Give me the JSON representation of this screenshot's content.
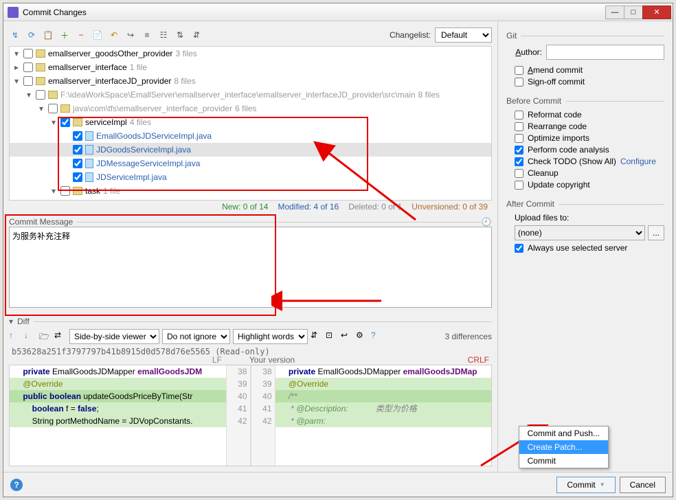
{
  "window": {
    "title": "Commit Changes"
  },
  "toolbar": {
    "changelist_label": "Changelist:",
    "changelist_value": "Default"
  },
  "tree": {
    "rows": [
      {
        "indent": 0,
        "chev": "▾",
        "checked": false,
        "type": "folder",
        "label": "emallserver_goodsOther_provider",
        "meta": "3 files"
      },
      {
        "indent": 0,
        "chev": "▸",
        "checked": false,
        "type": "folder",
        "label": "emallserver_interface",
        "meta": "1 file"
      },
      {
        "indent": 0,
        "chev": "▾",
        "checked": false,
        "type": "folder",
        "label": "emallserver_interfaceJD_provider",
        "meta": "8 files"
      },
      {
        "indent": 1,
        "chev": "▾",
        "checked": false,
        "type": "folder",
        "label": "F:\\ideaWorkSpace\\EmallServer\\emallserver_interface\\emallserver_interfaceJD_provider\\src\\main",
        "meta": "8 files",
        "gray_label": true
      },
      {
        "indent": 2,
        "chev": "▾",
        "checked": false,
        "type": "folder",
        "label": "java\\com\\tfs\\emallserver_interface_provider",
        "meta": "6 files",
        "gray_label": true
      },
      {
        "indent": 3,
        "chev": "▾",
        "checked": true,
        "type": "folder",
        "label": "serviceImpl",
        "meta": "4 files"
      },
      {
        "indent": 4,
        "chev": "",
        "checked": true,
        "type": "file",
        "label": "EmallGoodsJDServiceImpl.java",
        "link": true
      },
      {
        "indent": 4,
        "chev": "",
        "checked": true,
        "type": "file",
        "label": "JDGoodsServiceImpl.java",
        "link": true,
        "sel": true
      },
      {
        "indent": 4,
        "chev": "",
        "checked": true,
        "type": "file",
        "label": "JDMessageServiceImpl.java",
        "link": true
      },
      {
        "indent": 4,
        "chev": "",
        "checked": true,
        "type": "file",
        "label": "JDServiceImpl.java",
        "link": true
      },
      {
        "indent": 3,
        "chev": "▾",
        "checked": false,
        "type": "folder",
        "label": "task",
        "meta": "1 file"
      }
    ],
    "status": {
      "new": "New: 0 of 14",
      "modified": "Modified: 4 of 16",
      "deleted": "Deleted: 0 of 1",
      "unversioned": "Unversioned: 0 of 39"
    }
  },
  "commit_message": {
    "label": "Commit Message",
    "text": "为服务补充注释"
  },
  "diff": {
    "label": "Diff",
    "viewer": "Side-by-side viewer",
    "ignore": "Do not ignore",
    "highlight": "Highlight words",
    "count": "3 differences",
    "hash": "b53628a251f3797797b41b8915d0d578d76e5565 (Read-only)",
    "left_enc": "LF",
    "right_label": "Your version",
    "right_enc": "CRLF",
    "lines": [
      {
        "ln": 38,
        "left": "    private EmallGoodsJDMapper emallGoodsJDM",
        "right": "    private EmallGoodsJDMapper emallGoodsJDMap",
        "cls": ""
      },
      {
        "ln": 39,
        "left": "    @Override",
        "right": "    @Override",
        "cls": "green"
      },
      {
        "ln": 40,
        "left": "    public boolean updateGoodsPriceByTime(Str",
        "right": "    /**",
        "cls": "green-mid"
      },
      {
        "ln": 41,
        "left": "        boolean f = false;",
        "right": "     * @Description:            类型为价格",
        "cls": "green"
      },
      {
        "ln": 42,
        "left": "        String portMethodName = JDVopConstants.",
        "right": "     * @parm:",
        "cls": "green"
      }
    ]
  },
  "context_menu": {
    "items": [
      "Commit and Push...",
      "Create Patch...",
      "Commit"
    ],
    "selected": 1
  },
  "footer": {
    "commit": "Commit",
    "cancel": "Cancel"
  },
  "right": {
    "git": "Git",
    "author_label": "Author:",
    "amend": "Amend commit",
    "signoff": "Sign-off commit",
    "before_commit": "Before Commit",
    "reformat": "Reformat code",
    "rearrange": "Rearrange code",
    "optimize": "Optimize imports",
    "analysis": "Perform code analysis",
    "todo": "Check TODO (Show All)",
    "configure": "Configure",
    "cleanup": "Cleanup",
    "copyright": "Update copyright",
    "after_commit": "After Commit",
    "upload_label": "Upload files to:",
    "upload_value": "(none)",
    "always_server": "Always use selected server"
  }
}
